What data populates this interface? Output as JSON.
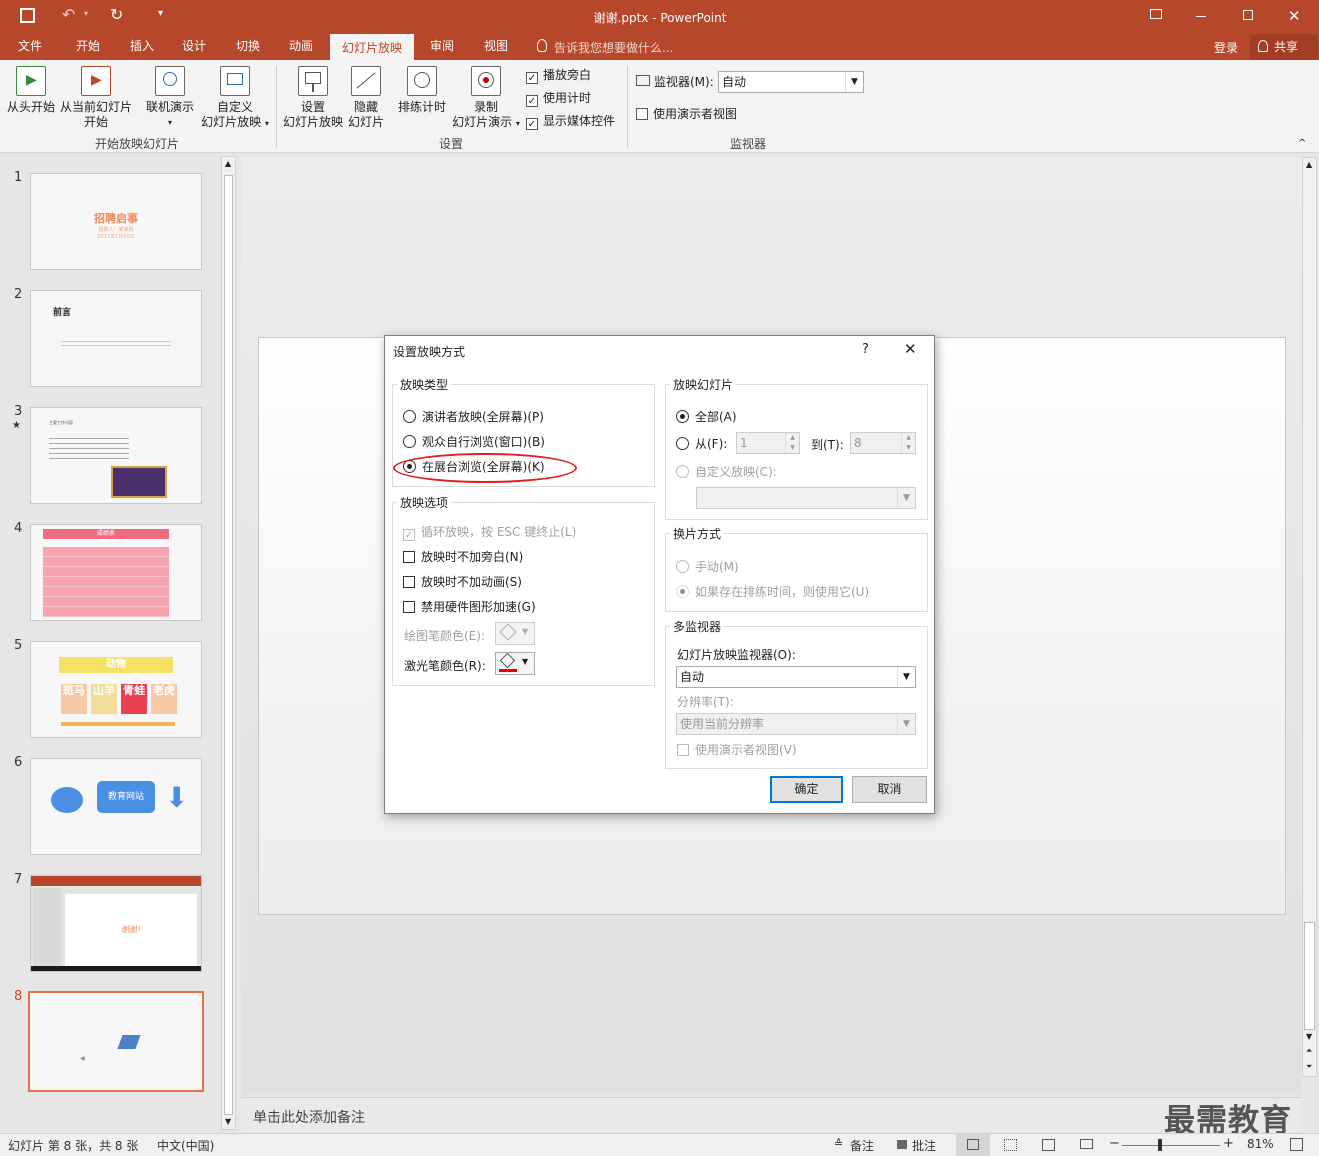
{
  "window": {
    "title": "谢谢.pptx - PowerPoint",
    "colors": {
      "accent": "#b7472a",
      "dialog_border": "#7f7f7f",
      "annotation_ellipse": "#e0201e",
      "default_button": "#0078d7"
    }
  },
  "quick_access": {
    "icons": [
      "save-icon",
      "undo-icon",
      "redo-icon",
      "customize-icon"
    ]
  },
  "tabs": [
    "文件",
    "开始",
    "插入",
    "设计",
    "切换",
    "动画",
    "幻灯片放映",
    "审阅",
    "视图"
  ],
  "active_tab": "幻灯片放映",
  "tell_me": "告诉我您想要做什么...",
  "account": {
    "login": "登录",
    "share": "共享"
  },
  "ribbon": {
    "groups": {
      "start": "开始放映幻灯片",
      "setup": "设置",
      "monitor": "监视器"
    },
    "buttons": {
      "from_start": "从头开始",
      "from_current_1": "从当前幻灯片",
      "from_current_2": "开始",
      "online": "联机演示",
      "custom_1": "自定义",
      "custom_2": "幻灯片放映",
      "setup_1": "设置",
      "setup_2": "幻灯片放映",
      "hide_1": "隐藏",
      "hide_2": "幻灯片",
      "rehearse": "排练计时",
      "record_1": "录制",
      "record_2": "幻灯片演示"
    },
    "checks": {
      "play_narration": "播放旁白",
      "use_timings": "使用计时",
      "show_media": "显示媒体控件",
      "presenter_view": "使用演示者视图"
    },
    "monitor_label": "监视器(M):",
    "monitor_value": "自动"
  },
  "slides": [
    {
      "num": "1",
      "title": "招聘启事",
      "sub1": "招聘人：某某网",
      "sub2": "2017年1月10日"
    },
    {
      "num": "2",
      "title": "前言"
    },
    {
      "num": "3",
      "star": "★",
      "title": "主要工作内容"
    },
    {
      "num": "4",
      "title": "成绩表"
    },
    {
      "num": "5",
      "title": "动物",
      "cells": [
        "斑马",
        "山羊",
        "青蛙",
        "老虎"
      ]
    },
    {
      "num": "6",
      "title": "教育网站"
    },
    {
      "num": "7",
      "title": "谢谢!"
    },
    {
      "num": "8"
    }
  ],
  "notes_placeholder": "单击此处添加备注",
  "status": {
    "slide_info": "幻灯片 第 8 张，共 8 张",
    "language": "中文(中国)",
    "notes": "备注",
    "comments": "批注",
    "zoom": "81%"
  },
  "watermark": "最需教育",
  "dialog": {
    "title": "设置放映方式",
    "help": "?",
    "close": "✕",
    "show_type": {
      "legend": "放映类型",
      "options": [
        "演讲者放映(全屏幕)(P)",
        "观众自行浏览(窗口)(B)",
        "在展台浏览(全屏幕)(K)"
      ],
      "selected": "在展台浏览(全屏幕)(K)"
    },
    "show_options": {
      "legend": "放映选项",
      "loop": "循环放映，按 ESC 键终止(L)",
      "no_narration": "放映时不加旁白(N)",
      "no_animation": "放映时不加动画(S)",
      "disable_hw": "禁用硬件图形加速(G)",
      "pen_color": "绘图笔颜色(E):",
      "laser_color": "激光笔颜色(R):"
    },
    "show_slides": {
      "legend": "放映幻灯片",
      "all": "全部(A)",
      "from": "从(F):",
      "from_value": "1",
      "to": "到(T):",
      "to_value": "8",
      "custom": "自定义放映(C):"
    },
    "advance": {
      "legend": "换片方式",
      "manual": "手动(M)",
      "timings": "如果存在排练时间，则使用它(U)"
    },
    "multi_monitor": {
      "legend": "多监视器",
      "monitor_label": "幻灯片放映监视器(O):",
      "monitor_value": "自动",
      "resolution_label": "分辨率(T):",
      "resolution_value": "使用当前分辨率",
      "presenter_view": "使用演示者视图(V)"
    },
    "ok": "确定",
    "cancel": "取消"
  }
}
